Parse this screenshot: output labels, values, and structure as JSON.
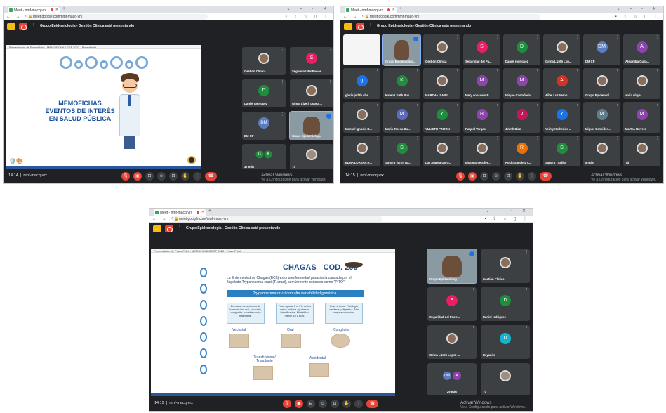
{
  "colors": {
    "meet_dark": "#202124",
    "tile": "#3c4043",
    "end_red": "#ea4335",
    "hand_yellow": "#fbbc04",
    "slide_blue": "#1d4f9a"
  },
  "shots": [
    {
      "browser": {
        "tab_title": "Meet - nmf-macq-vrx",
        "url": "meet.google.com/nmf-macq-vrx"
      },
      "presenting": "Grupo Epidemiologia - Gestión Clinica está presentando",
      "ppt_header": "Presentación de PowerPoint - MEMOFICHAS ESP 2022 - PowerPoint",
      "slide": {
        "title_lines": [
          "MEMOFICHAS",
          "EVENTOS DE INTERÉS",
          "EN SALUD PÚBLICA"
        ]
      },
      "tiles": [
        {
          "name": "Gestión Clínica"
        },
        {
          "name": "Seguridad del Pacien...",
          "initial": "S",
          "color": "#e91e63"
        },
        {
          "name": "Daniel rodriguez",
          "initial": "D",
          "color": "#1e8e3e"
        },
        {
          "name": "Ginna Lizeth Lopez ..."
        },
        {
          "name": "DM CP",
          "initial": "DM",
          "color": "#5c7cbf"
        },
        {
          "name": "Grupo Epidemiolog..."
        },
        {
          "name": "37 más",
          "initials": [
            "G",
            "K"
          ]
        },
        {
          "name": "Tú"
        }
      ],
      "time": "14:14",
      "meeting_code": "nmf-macq-vrx",
      "activate": {
        "title": "Activar Windows",
        "sub": "Ve a Configuración para activar Windows."
      }
    },
    {
      "browser": {
        "tab_title": "Meet - nmf-macq-vrx",
        "url": "meet.google.com/nmf-macq-vrx"
      },
      "presenting": "Grupo Epidemiologia - Gestión Clinica está presentando",
      "tiles": [
        {
          "name": ""
        },
        {
          "name": "Grupo Epidemiolog..."
        },
        {
          "name": "Gestión Clínica"
        },
        {
          "name": "Seguridad del Pa...",
          "initial": "S",
          "color": "#e91e63"
        },
        {
          "name": "Daniel rodriguez",
          "initial": "D",
          "color": "#1e8e3e"
        },
        {
          "name": "Ginna Lizeth Lop..."
        },
        {
          "name": "DM CP",
          "initial": "DM",
          "color": "#5c7cbf"
        },
        {
          "name": "Alejandra Guila...",
          "initial": "A",
          "color": "#8e44ad"
        },
        {
          "name": "gloria judith cha...",
          "initial": "g",
          "color": "#1a73e8"
        },
        {
          "name": "Karen Lizeth Bus...",
          "initial": "K",
          "color": "#1e8e3e"
        },
        {
          "name": "MARTHA ISABEL ..."
        },
        {
          "name": "Mery consuelo B...",
          "initial": "M",
          "color": "#8e44ad"
        },
        {
          "name": "Miryan Castañeda",
          "initial": "M",
          "color": "#8e44ad"
        },
        {
          "name": "Aibel Luz Veron",
          "initial": "A",
          "color": "#d93025"
        },
        {
          "name": "Grupo Epidemiol..."
        },
        {
          "name": "anita olaya"
        },
        {
          "name": "Manuel Ignacio B..."
        },
        {
          "name": "Maria Teresa Du...",
          "initial": "M",
          "color": "#5c6bc0"
        },
        {
          "name": "YULIETH PINZON",
          "initial": "Y",
          "color": "#1e8e3e"
        },
        {
          "name": "Raquel Vargas",
          "initial": "R",
          "color": "#8e44ad"
        },
        {
          "name": "Jineth Diaz",
          "initial": "J",
          "color": "#c2185b"
        },
        {
          "name": "Yeimy Katherine ...",
          "initial": "Y",
          "color": "#1a73e8"
        },
        {
          "name": "Miguel Esneider ...",
          "initial": "M",
          "color": "#607d8b"
        },
        {
          "name": "Martha Herrera",
          "initial": "M",
          "color": "#8e44ad"
        },
        {
          "name": "EDNA LORENA R..."
        },
        {
          "name": "Sandra Varon Ba...",
          "initial": "S",
          "color": "#1e8e3e"
        },
        {
          "name": "Luz Angela Gonz..."
        },
        {
          "name": "gina marcela for..."
        },
        {
          "name": "Rocio Sanchez C...",
          "initial": "R",
          "color": "#e8710a"
        },
        {
          "name": "Sandra Trujillo",
          "initial": "S",
          "color": "#1e8e3e"
        },
        {
          "name": "5 más"
        },
        {
          "name": "Tú"
        }
      ],
      "time": "14:15",
      "meeting_code": "nmf-macq-vrx",
      "activate": {
        "title": "Activar Windows",
        "sub": "Ve a Configuración para activar Windows."
      }
    },
    {
      "browser": {
        "tab_title": "Meet - nmf-macq-vrx",
        "url": "meet.google.com/nmf-macq-vrx"
      },
      "presenting": "Grupo Epidemiologia - Gestión Clinica está presentando",
      "ppt_header": "Presentación de PowerPoint - MEMOFICHAS ESP 2022 - PowerPoint",
      "slide": {
        "title": "CHAGAS",
        "code": "COD. 205",
        "definition": "La Enfermedad de Chagas (ECh) es una enfermedad parasitaria causada por el flagelado Trypanosoma cruzi (T. cruzi), comúnmente conocido como \"PITO\".",
        "band": "Trypanosoma cruzi con alta variabilidad genética.",
        "boxes": [
          "Diversos mecanismos de transmisión: oral, vectorial, congénita, transfusional y trasplante.",
          "Fase aguda: 5 al 2% de los casos en fase aguda son identificados. Mortalidad menor 10 y 80%.",
          "Fase crónica: Patología cardiaca y digestiva. Alta carga económica."
        ],
        "routes": [
          "Vectorial",
          "Oral",
          "Congénita",
          "Transfusional/ Trasplante",
          "Accidental"
        ]
      },
      "tiles": [
        {
          "name": "Grupo Epidemiolog..."
        },
        {
          "name": "Gestión Clínica"
        },
        {
          "name": "Seguridad del Pacie...",
          "initial": "S",
          "color": "#e91e63"
        },
        {
          "name": "Daniel rodriguez",
          "initial": "D",
          "color": "#1e8e3e"
        },
        {
          "name": "Ginna Lizeth Lopez ..."
        },
        {
          "name": "Deyanira",
          "initial": "D",
          "color": "#12b5cb"
        },
        {
          "name": "29 más",
          "initials": [
            "DM",
            "A"
          ]
        },
        {
          "name": "Tú"
        }
      ],
      "time": "14:19",
      "meeting_code": "nmf-macq-vrx",
      "activate": {
        "title": "Activar Windows",
        "sub": "Ve a Configuración para activar Windows."
      }
    }
  ]
}
